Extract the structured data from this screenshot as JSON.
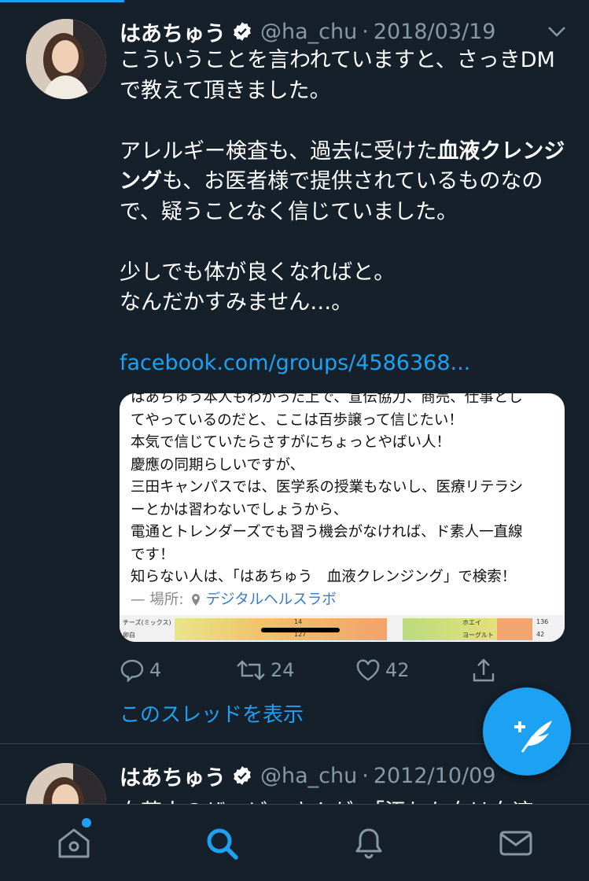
{
  "tweets": [
    {
      "name": "はあちゅう",
      "handle": "@ha_chu",
      "date": "2018/03/19",
      "text": {
        "p1": "こういうことを言われていますと、さっきDMで教えて頂きました。",
        "p2_a": "アレルギー検査も、過去に受けた",
        "p2_b": "血液クレンジング",
        "p2_c": "も、お医者様で提供されているものなので、疑うことなく信じていました。",
        "p3_l1": "少しでも体が良くなればと。",
        "p3_l2": "なんだかすみません…。",
        "link": "facebook.com/groups/4586368..."
      },
      "media": {
        "lines": [
          "はあちゅう本人もわかった上で、宣伝協力、商売、仕事とし",
          "てやっているのだと、ここは百歩譲って信じたい！",
          "本気で信じていたらさすがにちょっとやばい人！",
          "慶應の同期らしいですが、",
          "三田キャンパスでは、医学系の授業もないし、医療リテラシ",
          "ーとかは習わないでしょうから、",
          "電通とトレンダーズでも習う機会がなければ、ド素人一直線",
          "です！",
          "知らない人は、「はあちゅう　血液クレンジング」で検索！"
        ],
        "location_label": "— 場所:",
        "location_name": "デジタルヘルスラボ",
        "chart_labels": [
          "チーズ(ミックス)",
          "14",
          "ホエイ",
          "136",
          "卵白",
          "127",
          "ヨーグルト",
          "42"
        ]
      },
      "actions": {
        "replies": "4",
        "retweets": "24",
        "likes": "42"
      },
      "thread_link": "このスレッドを表示"
    },
    {
      "name": "はあちゅう",
      "handle": "@ha_chu",
      "date": "2012/10/09",
      "text_preview": "女芸人のザ・ビーさんが、「汚れた血は血液"
    }
  ],
  "nav": {
    "items": [
      "home-icon",
      "search-icon",
      "notifications-icon",
      "messages-icon"
    ],
    "active": "search-icon"
  },
  "colors": {
    "accent": "#1da1f2",
    "background": "#15202b",
    "muted": "#8899a6"
  }
}
